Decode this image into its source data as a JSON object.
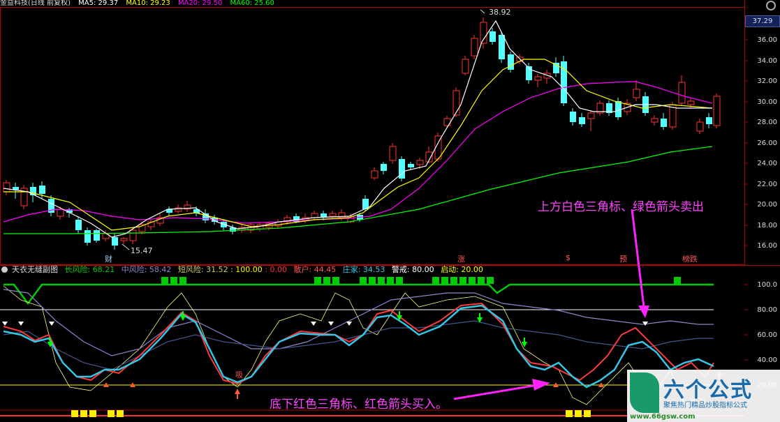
{
  "main_header": {
    "stock_name": "金益科技(日线 前复权)",
    "ma5": "MA5: 29.37",
    "ma10": "MA10: 29.23",
    "ma20": "MA20: 29.50",
    "ma60": "MA60: 25.60"
  },
  "current_price": "37.29",
  "y_axis": [
    "36.00",
    "34.00",
    "32.00",
    "30.00",
    "28.00",
    "26.00",
    "24.00",
    "22.00",
    "20.00",
    "18.00",
    "16.00"
  ],
  "high_label": "38.92",
  "low_label": "15.47",
  "markers": {
    "cai": "财",
    "zhang": "涨",
    "s": "$",
    "yu": "预",
    "bang": "榜跌"
  },
  "annotations": {
    "top": "上方白色三角标、绿色箭头卖出",
    "bottom": "底下红色三角标、红色箭头买入。"
  },
  "sub_header": {
    "title": "天衣无缝副图",
    "long_risk": "长风险: 68.21",
    "mid_risk": "中风险: 58.42",
    "short_risk": "短风险: 31.52",
    "v100": ": 100.00",
    "v0": ": 0.00",
    "retail": "散户: 44.45",
    "dealer": "庄家: 34.53",
    "alert": "警戒: 80.00",
    "start": "启动: 20.00"
  },
  "sub_y_axis": [
    "100.0",
    "80.00",
    "60.00",
    "40.00",
    "20.00"
  ],
  "sub_inner_label": "吸",
  "logo": {
    "title": "六个公式",
    "sub": "聚焦热门精品炒股指标公式",
    "url": "www.66gsw.com"
  },
  "colors": {
    "up": "#ff3232",
    "down": "#54ffff",
    "ma5": "#ffffff",
    "ma10": "#ffff00",
    "ma20": "#ff00ff",
    "ma60": "#00ff00"
  },
  "icons": [
    "collapse-circle-icon",
    "gear-icon"
  ]
}
